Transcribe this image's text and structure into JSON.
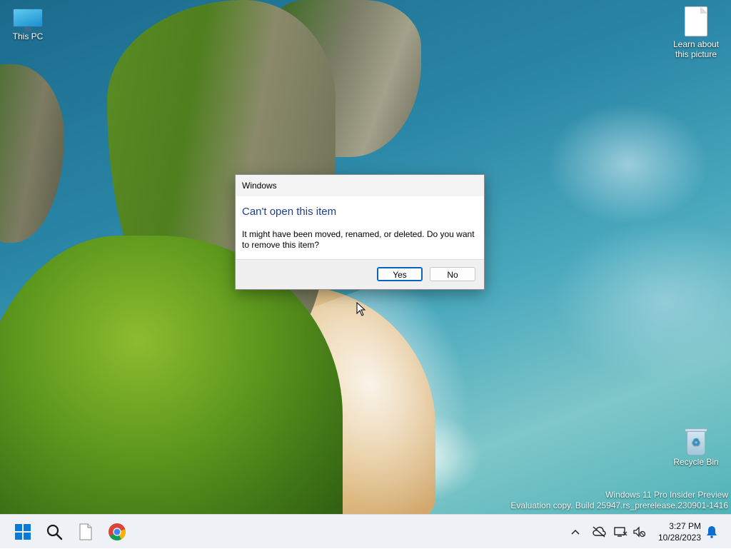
{
  "desktop": {
    "icons": [
      {
        "label": "This PC",
        "icon": "monitor-icon"
      },
      {
        "label": "Learn about this picture",
        "icon": "document-icon"
      },
      {
        "label": "Recycle Bin",
        "icon": "recycle-bin-icon"
      }
    ],
    "watermark": {
      "line1": "Windows 11 Pro Insider Preview",
      "line2": "Evaluation copy. Build 25947.rs_prerelease.230901-1416"
    }
  },
  "dialog": {
    "title": "Windows",
    "heading": "Can't open this item",
    "message": "It might have been moved, renamed, or deleted. Do you want to remove this item?",
    "buttons": {
      "yes": "Yes",
      "no": "No"
    },
    "heading_color": "#1d3f8f"
  },
  "taskbar": {
    "pinned": [
      {
        "name": "start",
        "icon": "windows-logo-icon"
      },
      {
        "name": "search",
        "icon": "search-icon"
      },
      {
        "name": "file-explorer",
        "icon": "blank-document-icon"
      },
      {
        "name": "chrome",
        "icon": "chrome-icon"
      }
    ],
    "tray": {
      "icons": [
        "chevron-up-icon",
        "onedrive-offline-icon",
        "network-icon",
        "speaker-muted-icon",
        "notification-bell-icon"
      ],
      "time": "3:27 PM",
      "date": "10/28/2023"
    },
    "accent": "#0a7ad6"
  }
}
